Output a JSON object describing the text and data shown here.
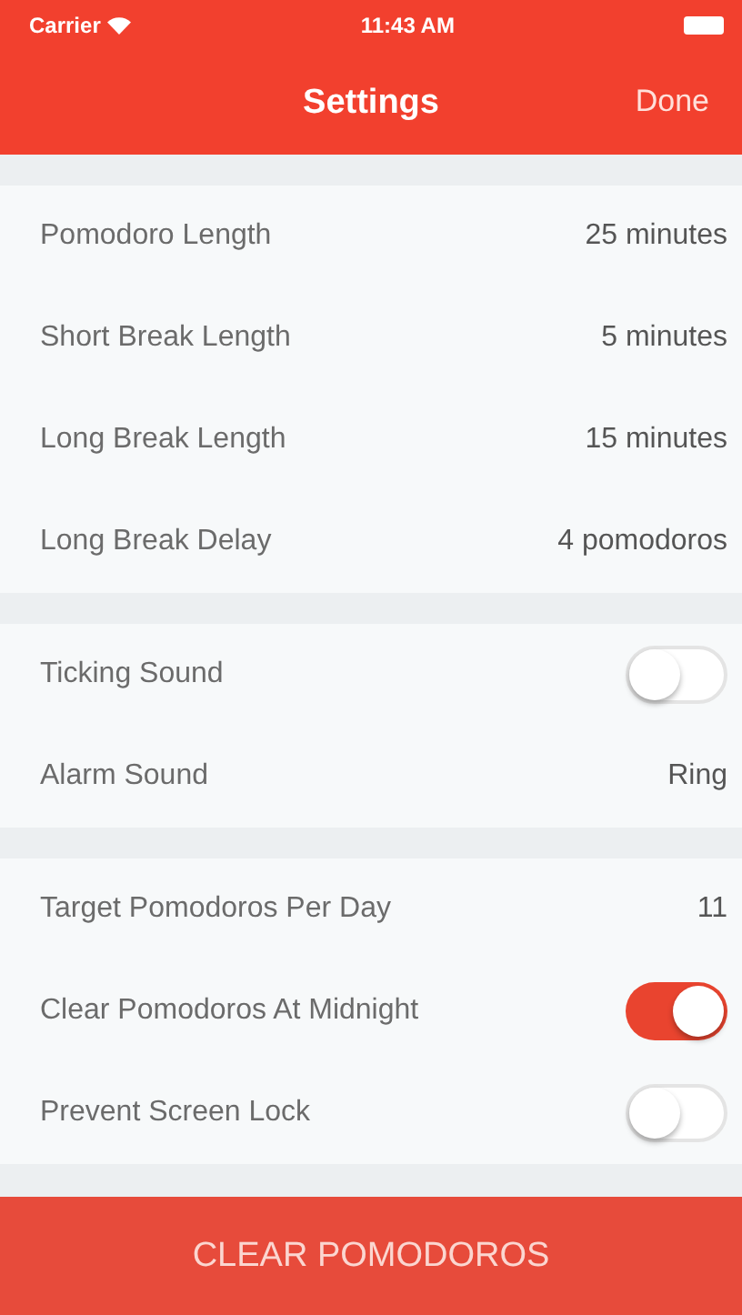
{
  "status_bar": {
    "carrier": "Carrier",
    "time": "11:43 AM"
  },
  "nav": {
    "title": "Settings",
    "action": "Done"
  },
  "groups": [
    {
      "rows": [
        {
          "kind": "value",
          "label": "Pomodoro Length",
          "value": "25 minutes"
        },
        {
          "kind": "value",
          "label": "Short Break Length",
          "value": "5 minutes"
        },
        {
          "kind": "value",
          "label": "Long Break Length",
          "value": "15 minutes"
        },
        {
          "kind": "value",
          "label": "Long Break Delay",
          "value": "4 pomodoros"
        }
      ]
    },
    {
      "rows": [
        {
          "kind": "switch",
          "label": "Ticking Sound",
          "on": false
        },
        {
          "kind": "value",
          "label": "Alarm Sound",
          "value": "Ring"
        }
      ]
    },
    {
      "rows": [
        {
          "kind": "value",
          "label": "Target Pomodoros Per Day",
          "value": "11"
        },
        {
          "kind": "switch",
          "label": "Clear Pomodoros At Midnight",
          "on": true
        },
        {
          "kind": "switch",
          "label": "Prevent Screen Lock",
          "on": false
        }
      ]
    }
  ],
  "clear_button": "CLEAR POMODOROS"
}
